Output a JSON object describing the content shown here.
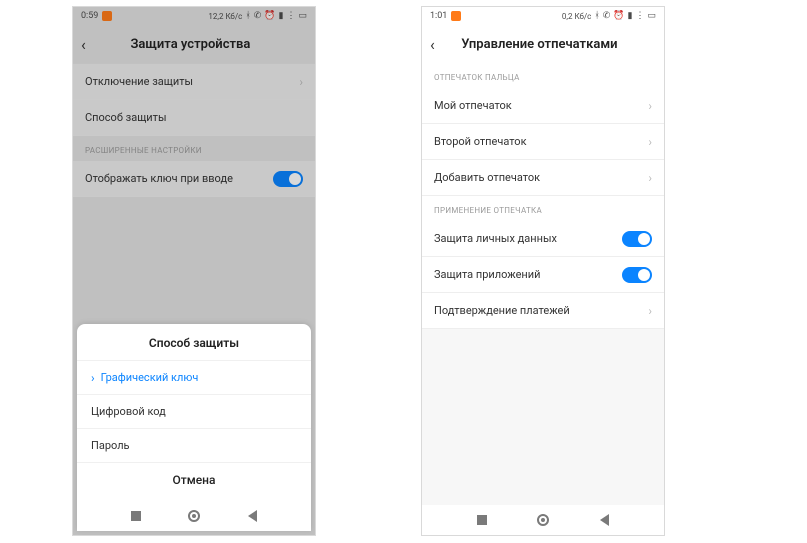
{
  "left": {
    "status": {
      "time": "0:59",
      "speed": "12,2 Кб/с"
    },
    "header": {
      "title": "Защита устройства"
    },
    "rows": {
      "disable": "Отключение защиты",
      "method": "Способ защиты"
    },
    "section_advanced": "РАСШИРЕННЫЕ НАСТРОЙКИ",
    "show_key": "Отображать ключ при вводе",
    "sheet": {
      "title": "Способ защиты",
      "opt_pattern": "Графический ключ",
      "opt_pin": "Цифровой код",
      "opt_password": "Пароль",
      "cancel": "Отмена"
    }
  },
  "right": {
    "status": {
      "time": "1:01",
      "speed": "0,2 Кб/с"
    },
    "header": {
      "title": "Управление отпечатками"
    },
    "section_fp": "ОТПЕЧАТОК ПАЛЬЦА",
    "fp1": "Мой отпечаток",
    "fp2": "Второй отпечаток",
    "fp_add": "Добавить отпечаток",
    "section_use": "ПРИМЕНЕНИЕ ОТПЕЧАТКА",
    "privacy": "Защита личных данных",
    "apps": "Защита приложений",
    "payments": "Подтверждение платежей"
  }
}
